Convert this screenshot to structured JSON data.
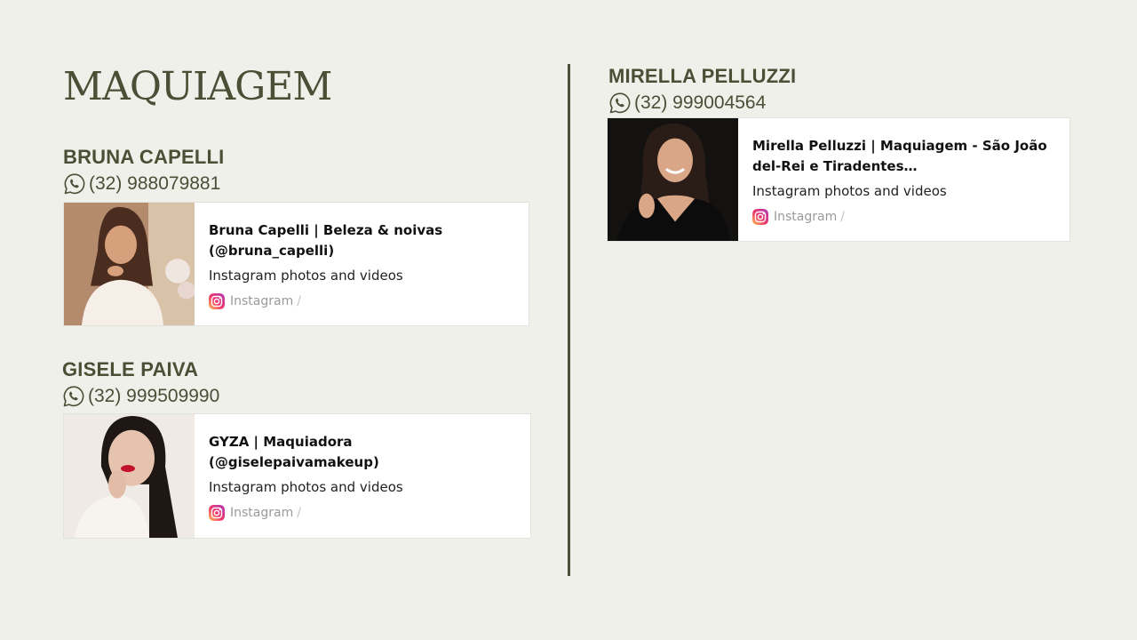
{
  "page": {
    "title": "MAQUIAGEM"
  },
  "icons": {
    "phone": "whatsapp-icon",
    "source": "instagram-icon"
  },
  "colors": {
    "background": "#f0f0eb",
    "text": "#4a4f36",
    "divider": "#4d4f3b"
  },
  "artists": [
    {
      "name": "BRUNA CAPELLI",
      "phone": "(32) 988079881",
      "card": {
        "title": "Bruna Capelli | Beleza & noivas (@bruna_capelli)",
        "description": "Instagram photos and videos",
        "source": "Instagram",
        "separator": "/"
      }
    },
    {
      "name": "GISELE PAIVA",
      "phone": "(32) 999509990",
      "card": {
        "title": "GYZA | Maquiadora (@giselepaivamakeup)",
        "description": "Instagram photos and videos",
        "source": "Instagram",
        "separator": "/"
      }
    },
    {
      "name": "MIRELLA PELLUZZI",
      "phone": "(32) 999004564",
      "card": {
        "title": "Mirella Pelluzzi | Maquiagem - São João del-Rei e Tiradentes…",
        "description": "Instagram photos and videos",
        "source": "Instagram",
        "separator": "/"
      }
    }
  ]
}
